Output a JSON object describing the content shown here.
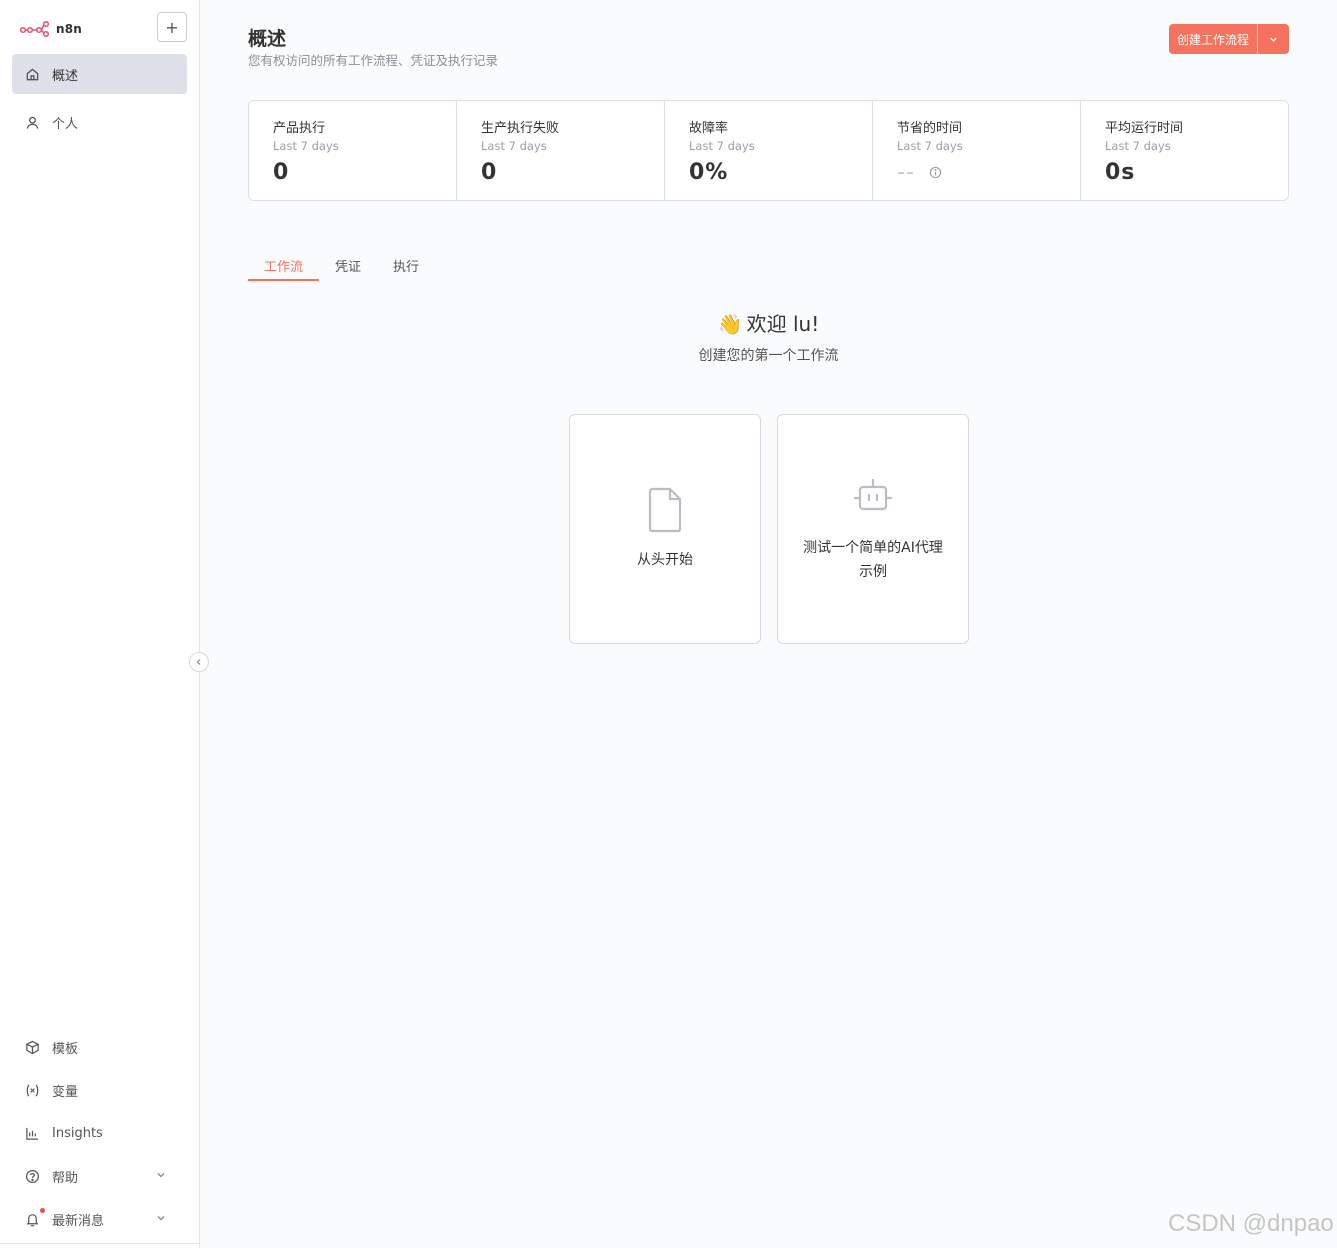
{
  "app": {
    "logo_text": "n8n",
    "add_label": "+"
  },
  "sidebar": {
    "top_items": [
      {
        "label": "概述",
        "icon": "home-icon",
        "active": true
      },
      {
        "label": "个人",
        "icon": "user-icon",
        "active": false
      }
    ],
    "bottom_items": [
      {
        "label": "模板",
        "icon": "box-icon"
      },
      {
        "label": "变量",
        "icon": "variable-icon"
      },
      {
        "label": "Insights",
        "icon": "chart-icon"
      },
      {
        "label": "帮助",
        "icon": "help-icon",
        "expandable": true
      },
      {
        "label": "最新消息",
        "icon": "bell-icon",
        "expandable": true,
        "notification_dot": true
      }
    ]
  },
  "header": {
    "title": "概述",
    "subtitle": "您有权访问的所有工作流程、凭证及执行记录",
    "create_label": "创建工作流程"
  },
  "stats": [
    {
      "label": "产品执行",
      "period": "Last 7 days",
      "value": "0"
    },
    {
      "label": "生产执行失败",
      "period": "Last 7 days",
      "value": "0"
    },
    {
      "label": "故障率",
      "period": "Last 7 days",
      "value": "0%"
    },
    {
      "label": "节省的时间",
      "period": "Last 7 days",
      "value": "--"
    },
    {
      "label": "平均运行时间",
      "period": "Last 7 days",
      "value": "0s"
    }
  ],
  "tabs": [
    {
      "label": "工作流",
      "active": true
    },
    {
      "label": "凭证",
      "active": false
    },
    {
      "label": "执行",
      "active": false
    }
  ],
  "welcome": {
    "emoji": "👋",
    "title": "欢迎 lu!",
    "subtitle": "创建您的第一个工作流"
  },
  "cards": [
    {
      "label": "从头开始",
      "icon": "file-icon"
    },
    {
      "label": "测试一个简单的AI代理示例",
      "icon": "robot-icon"
    }
  ],
  "watermark": "CSDN @dnpao",
  "colors": {
    "accent": "#f5735e",
    "active_nav": "#dee1ea"
  }
}
